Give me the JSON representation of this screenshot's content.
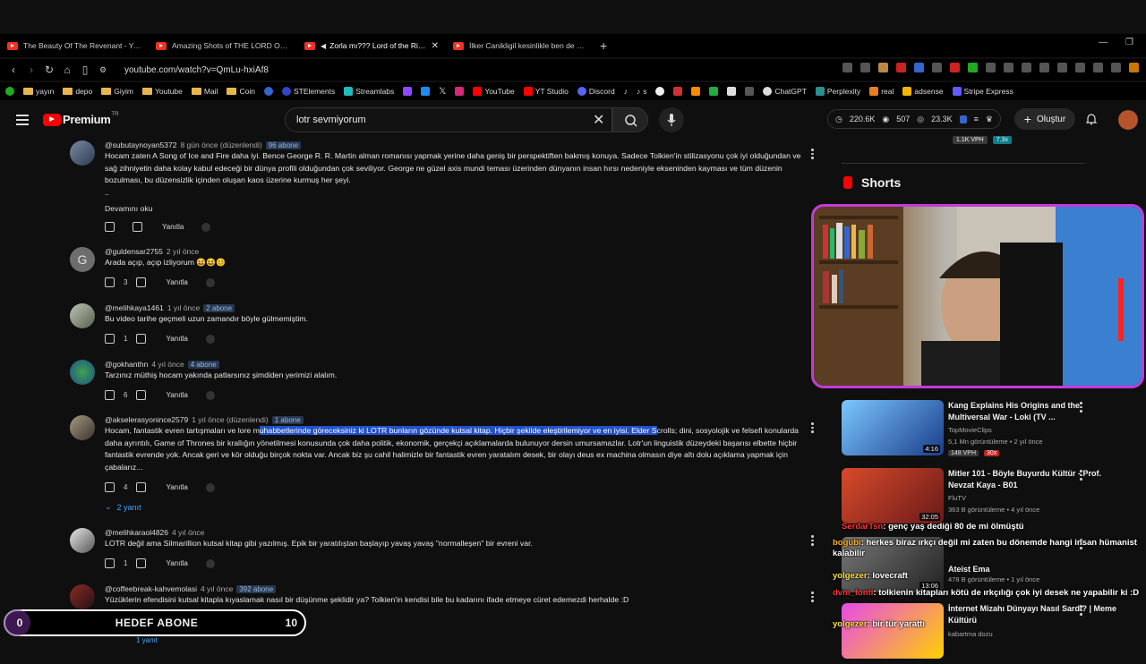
{
  "browser": {
    "tabs": [
      {
        "title": "The Beauty Of The Revenant - YouTube",
        "active": false
      },
      {
        "title": "Amazing Shots of THE LORD OF THE RINGS",
        "active": false
      },
      {
        "title": "Zorla mı??? Lord of the Rings",
        "active": true
      },
      {
        "title": "İlker Canikligil kesinlikle ben de öyle",
        "active": false
      }
    ],
    "new_tab": "+",
    "url": "youtube.com/watch?v=QmLu-hxiAf8",
    "bookmarks": [
      "yayın",
      "depo",
      "Giyim",
      "Youtube",
      "Mail",
      "Coin",
      "STElements",
      "Streamlabs",
      "YouTube",
      "YT Studio",
      "Discord",
      "s",
      "ChatGPT",
      "Perplexity",
      "real",
      "adsense",
      "Stripe Express"
    ]
  },
  "youtube": {
    "logo": "Premium",
    "logo_sup": "TR",
    "search_value": "lotr sevmiyorum",
    "stats": {
      "viewers": "220.6K",
      "likes": "507",
      "subs": "23.3K"
    },
    "create_label": "Oluştur"
  },
  "comments": [
    {
      "handle": "@subutaynoyan5372",
      "time": "8 gün önce (düzenlendi)",
      "badge": "96 abone",
      "body": "Hocam zaten A Song of Ice and Fire daha iyi. Bence George R. R. Martin alman romanısı yapmak yerine daha geniş bir perspektiften bakmış konuya. Sadece Tolkien'in stilizasyonu çok iyi olduğundan ve sağ zihniyetin daha kolay kabul edeceği bir dünya profili olduğundan çok seviliyor. George ne güzel axis mundi teması üzerinden dünyanın insan hırsı nedeniyle ekseninden kayması ve tüm düzenin bozulması, bu düzensizlik içinden oluşan kaos üzerine kurmuş her şeyi.",
      "ellipsis": "..",
      "read_more": "Devamını oku",
      "likes": "",
      "reply": "Yanıtla"
    },
    {
      "handle": "@guldensar2755",
      "time": "2 yıl önce",
      "badge": "",
      "body": "Arada açıp, açıp izliyorum 😆😆😊",
      "likes": "3",
      "reply": "Yanıtla"
    },
    {
      "handle": "@melihkaya1461",
      "time": "1 yıl önce",
      "badge": "2 abone",
      "body": "Bu video tarihe geçmeli uzun zamandır böyle gülmemiştim.",
      "likes": "1",
      "reply": "Yanıtla"
    },
    {
      "handle": "@gokhanthn",
      "time": "4 yıl önce",
      "badge": "4 abone",
      "body": "Tarzınız müthiş hocam yakında patlarsınız şimdiden yerimizi alalım.",
      "likes": "6",
      "reply": "Yanıtla"
    },
    {
      "handle": "@akselerasyonince2579",
      "time": "1 yıl önce (düzenlendi)",
      "badge": "1 abone",
      "body_pre": "Hocam, fantastik evren tartışmaları ve lore m",
      "body_hl": "uhabbetlerinde göreceksiniz ki LOTR bunların gözünde kutsal kitap. Hiçbir şekilde eleştirilemiyor ve en iyisi. Elder S",
      "body_post": "crolls; dini, sosyolojik ve felsefi konularda daha ayrıntılı, Game of Thrones bir krallığın yönetilmesi konusunda çok daha politik, ekonomik, gerçekçi açıklamalarda bulunuyor dersin umursamazlar.  Lotr'un linguistik düzeydeki başarısı elbette hiçbir fantastik evrende yok. Ancak geri ve kör olduğu birçok nokta var.  Ancak biz şu cahil halimizle bir fantastik evren yaratalım desek, bir olayı deus ex machina olmasın diye altı dolu açıklama yapmak için çabalarız...",
      "likes": "4",
      "reply": "Yanıtla",
      "replies": "2 yanıt"
    },
    {
      "handle": "@melihkaraol4826",
      "time": "4 yıl önce",
      "badge": "",
      "body": "LOTR değil ama Silmarillion kutsal kitap gibi yazılmış. Epik bir yaratılıştan başlayıp yavaş yavaş \"normalleşen\" bir evreni var.",
      "likes": "1",
      "reply": "Yanıtla"
    },
    {
      "handle": "@coffeebreak-kahvemolasi",
      "time": "4 yıl önce",
      "badge": "392 abone",
      "body": "Yüzüklerin efendisini kutsal kitapla kıyaslamak nasıl bir düşünme şeklidir ya?  Tolkien'in kendisi bile bu kadarını ifade etmeye cüret edemezdi herhalde :D",
      "likes": "",
      "reply": "",
      "replies": "1 yanıt"
    }
  ],
  "sidebar": {
    "top_tags": [
      "1.1K VPH",
      "7.3x"
    ],
    "shorts_label": "Shorts",
    "videos": [
      {
        "title": "Kang Explains His Origins and the Multiversal War - Loki (TV ...",
        "channel": "TopMovieClips",
        "views": "5,1 Mn görüntüleme • 2 yıl önce",
        "duration": "4:16",
        "vph": "148 VPH",
        "mult": "30x"
      },
      {
        "title": "Mitler 101 - Böyle Buyurdu Kültür - Prof. Nevzat Kaya - B01",
        "channel": "FluTV",
        "views": "363 B görüntüleme • 4 yıl önce",
        "duration": "32:05",
        "vph": "",
        "mult": ""
      },
      {
        "title": "Ateist Ema",
        "channel": "Ateist Ema",
        "views": "478 B görüntüleme • 1 yıl önce",
        "duration": "13:06",
        "vph": "",
        "mult": ""
      },
      {
        "title": "İnternet Mizahı Dünyayı Nasıl Sardı? | Meme Kültürü",
        "channel": "kabartma dozu",
        "views": "",
        "duration": "",
        "vph": "",
        "mult": ""
      }
    ]
  },
  "overlay": {
    "chat": [
      {
        "user": "SerdarTsn",
        "msg": ": genç yaş dediği 80 de mi ölmüştü"
      },
      {
        "user": "bogubi",
        "msg": ": herkes biraz ırkçı değil mi zaten bu dönemde hangi insan hümanist kalabilir"
      },
      {
        "user": "yolgezer",
        "msg": ": lovecraft"
      },
      {
        "user": "dvm_fontl",
        "msg": ": tolkienin kitapları kötü de ırkçılığı çok iyi desek ne yapabilir ki :D"
      },
      {
        "user": "yolgezer",
        "msg": ": bir tür yarattı"
      }
    ],
    "goal": {
      "current": "0",
      "label": "HEDEF ABONE",
      "target": "10",
      "progress": 0
    }
  }
}
